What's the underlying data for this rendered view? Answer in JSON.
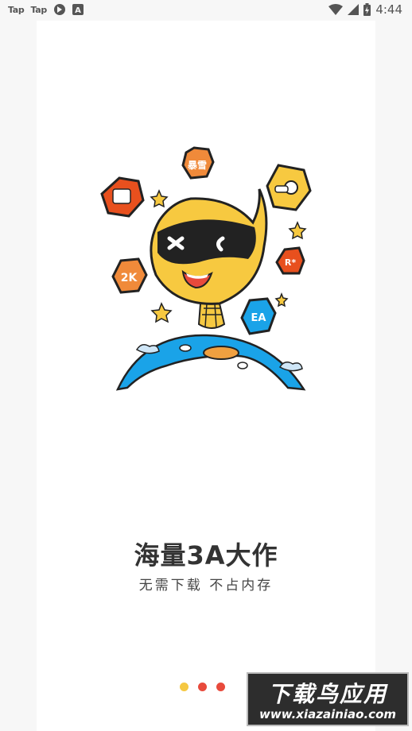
{
  "statusbar": {
    "app_label_1": "Tap",
    "app_label_2": "Tap",
    "time": "4:44"
  },
  "illustration": {
    "badges": [
      "暴雪",
      "EA",
      "2K",
      "R*"
    ]
  },
  "onboarding": {
    "title": "海量3A大作",
    "subtitle": "无需下载 不占内存",
    "pager": {
      "active_index": 0,
      "count": 3,
      "active_color": "#f5c842",
      "inactive_color": "#e84a3c"
    }
  },
  "watermark": {
    "main": "下载鸟应用",
    "sub": "www.xiazainiao.com"
  }
}
